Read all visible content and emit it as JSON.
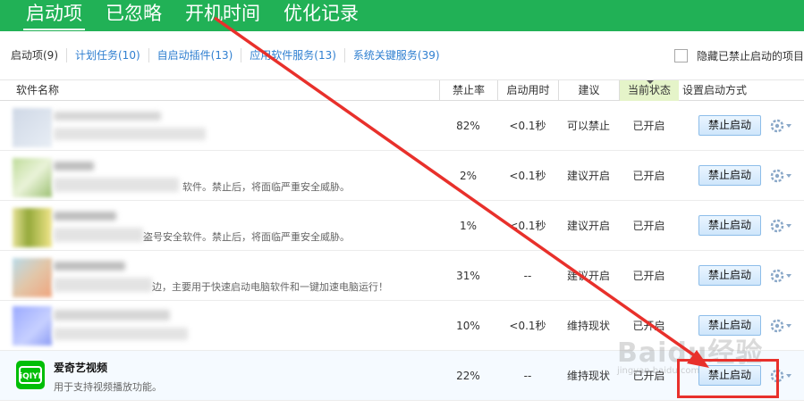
{
  "top_tabs": [
    "启动项",
    "已忽略",
    "开机时间",
    "优化记录"
  ],
  "sub_tabs": [
    "启动项(9)",
    "计划任务(10)",
    "自启动插件(13)",
    "应用软件服务(13)",
    "系统关键服务(39)"
  ],
  "hide_disabled_label": "隐藏已禁止启动的项目",
  "columns": {
    "name": "软件名称",
    "disable_rate": "禁止率",
    "startup_time": "启动用时",
    "advice": "建议",
    "status": "当前状态",
    "method": "设置启动方式"
  },
  "rows": [
    {
      "title": "",
      "desc": "",
      "rate": "82%",
      "time": "<0.1秒",
      "advice": "可以禁止",
      "status": "已开启",
      "action": "禁止启动"
    },
    {
      "title": "",
      "desc": "软件。禁止后，将面临严重安全威胁。",
      "rate": "2%",
      "time": "<0.1秒",
      "advice": "建议开启",
      "status": "已开启",
      "action": "禁止启动"
    },
    {
      "title": "",
      "desc": "盗号安全软件。禁止后，将面临严重安全威胁。",
      "rate": "1%",
      "time": "<0.1秒",
      "advice": "建议开启",
      "status": "已开启",
      "action": "禁止启动"
    },
    {
      "title": "",
      "desc": "边，主要用于快速启动电脑软件和一键加速电脑运行！",
      "rate": "31%",
      "time": "--",
      "advice": "建议开启",
      "status": "已开启",
      "action": "禁止启动"
    },
    {
      "title": "",
      "desc": "",
      "rate": "10%",
      "time": "<0.1秒",
      "advice": "维持现状",
      "status": "已开启",
      "action": "禁止启动"
    },
    {
      "title": "爱奇艺视频",
      "desc": "用于支持视频播放功能。",
      "rate": "22%",
      "time": "--",
      "advice": "维持现状",
      "status": "已开启",
      "action": "禁止启动"
    }
  ],
  "watermark": {
    "main": "Baidu经验",
    "sub": "jingyan.baidu.com"
  },
  "colors": {
    "header_green": "#21b156",
    "link_blue": "#2f7fd0",
    "annotation_red": "#e8302b",
    "status_col_bg": "#e5f4c9"
  },
  "icons": {
    "app_icon": "iqiyi-icon",
    "settings": "gear-icon"
  }
}
